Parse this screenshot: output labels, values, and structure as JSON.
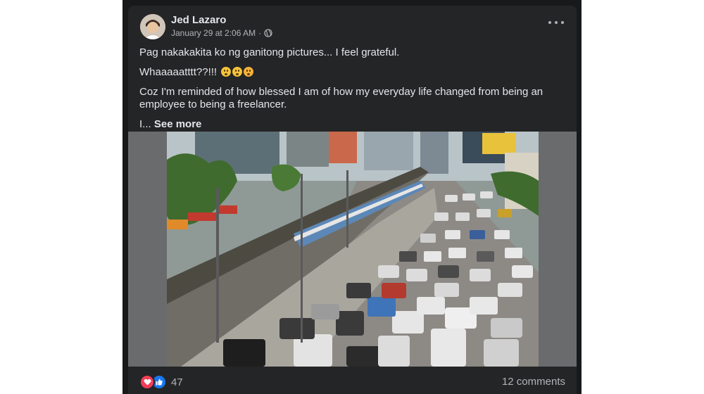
{
  "post": {
    "author": "Jed Lazaro",
    "timestamp": "January 29 at 2:06 AM",
    "separator": "·",
    "privacy_icon": "globe-icon",
    "menu_icon": "more-icon",
    "text": {
      "line1": "Pag nakakakita ko ng ganitong pictures... I feel grateful.",
      "line2": "Whaaaaatttt??!!!",
      "line2_emojis": [
        "tired-face-emoji",
        "hushed-face-emoji",
        "flushed-face-emoji"
      ],
      "line3": "Coz I'm reminded of how blessed I am of how my everyday life changed from being an employee to being a freelancer.",
      "line4_prefix": "I...",
      "see_more": "See more"
    }
  },
  "reactions": {
    "icons": [
      "love-icon",
      "like-icon"
    ],
    "count": "47",
    "comments": "12 comments"
  },
  "colors": {
    "card": "#242526",
    "text": "#e4e6eb",
    "secondary": "#b0b3b8",
    "love": "#f33e58",
    "like": "#1877f2"
  }
}
